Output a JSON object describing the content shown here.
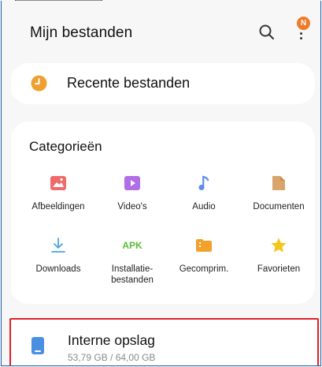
{
  "header": {
    "title": "Mijn bestanden",
    "notification_badge": "N"
  },
  "recent": {
    "label": "Recente bestanden"
  },
  "categories": {
    "title": "Categorieën",
    "items": [
      {
        "label": "Afbeeldingen",
        "icon": "image-icon"
      },
      {
        "label": "Video's",
        "icon": "video-icon"
      },
      {
        "label": "Audio",
        "icon": "music-note-icon"
      },
      {
        "label": "Documenten",
        "icon": "document-icon"
      },
      {
        "label": "Downloads",
        "icon": "download-icon"
      },
      {
        "label": "Installatie-\nbestanden",
        "icon": "apk-icon",
        "icon_text": "APK"
      },
      {
        "label": "Gecomprim.",
        "icon": "zip-folder-icon"
      },
      {
        "label": "Favorieten",
        "icon": "star-icon"
      }
    ]
  },
  "storage": {
    "title": "Interne opslag",
    "usage": "53,79 GB / 64,00 GB"
  },
  "colors": {
    "accent_orange": "#f0a030",
    "images_red": "#f06a6a",
    "video_purple": "#b06ee8",
    "audio_blue": "#5a8ef0",
    "documents_tan": "#d9a56b",
    "downloads_blue": "#4aa3e0",
    "apk_green": "#5bbf3a",
    "zip_orange": "#f2a12b",
    "star_yellow": "#f5c518",
    "storage_blue": "#4a8fe2",
    "highlight_red": "#e0212b"
  }
}
